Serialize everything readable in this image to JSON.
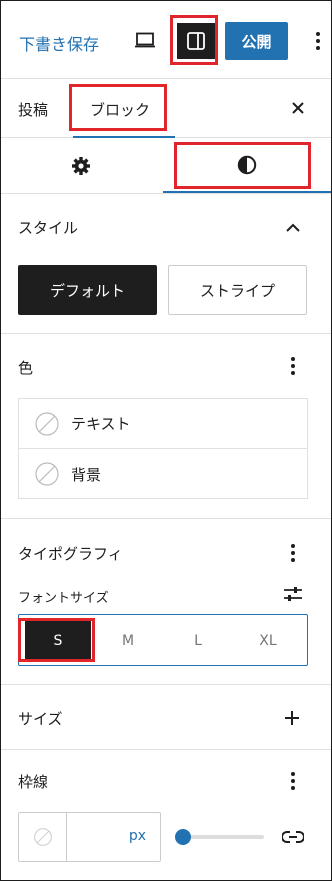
{
  "header": {
    "draft_label": "下書き保存",
    "publish_label": "公開"
  },
  "tabs": {
    "post": "投稿",
    "block": "ブロック"
  },
  "icons": {
    "view": "laptop-icon",
    "sidebar": "sidebar-toggle-icon",
    "more": "more-vertical-icon",
    "close": "close-icon",
    "settings": "gear-icon",
    "styles": "half-circle-icon"
  },
  "styles_panel": {
    "title": "スタイル",
    "options": [
      "デフォルト",
      "ストライプ"
    ],
    "selected": "デフォルト"
  },
  "color_panel": {
    "title": "色",
    "items": [
      "テキスト",
      "背景"
    ]
  },
  "typography_panel": {
    "title": "タイポグラフィ",
    "font_size_label": "フォントサイズ",
    "sizes": [
      "S",
      "M",
      "L",
      "XL"
    ],
    "selected": "S"
  },
  "size_panel": {
    "title": "サイズ"
  },
  "border_panel": {
    "title": "枠線",
    "unit": "px"
  },
  "colors": {
    "accent": "#2271b1",
    "dark": "#1e1e1e",
    "highlight": "#e0262a"
  }
}
